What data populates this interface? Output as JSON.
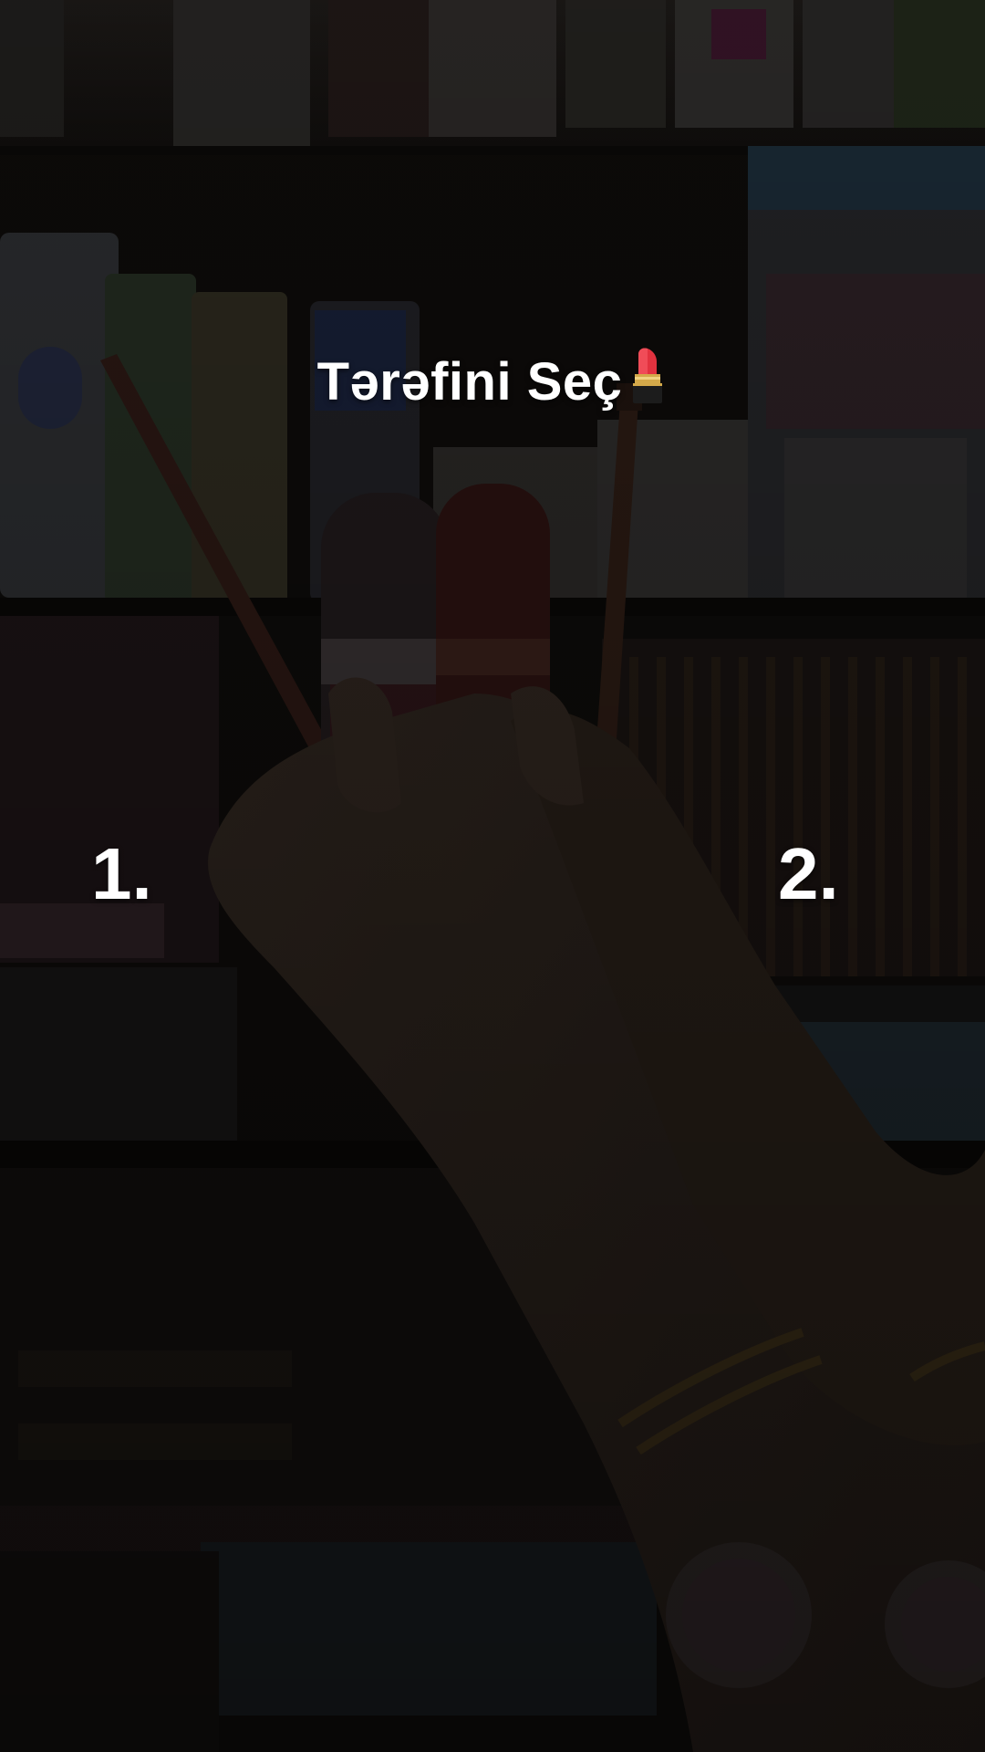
{
  "overlay": {
    "title": "Tərəfini Seç",
    "title_emoji": "lipstick-icon",
    "option_1": "1.",
    "option_2": "2."
  },
  "colors": {
    "text": "#ffffff",
    "lipstick_red": "#e2323f",
    "lipstick_gold": "#d4a94a"
  }
}
